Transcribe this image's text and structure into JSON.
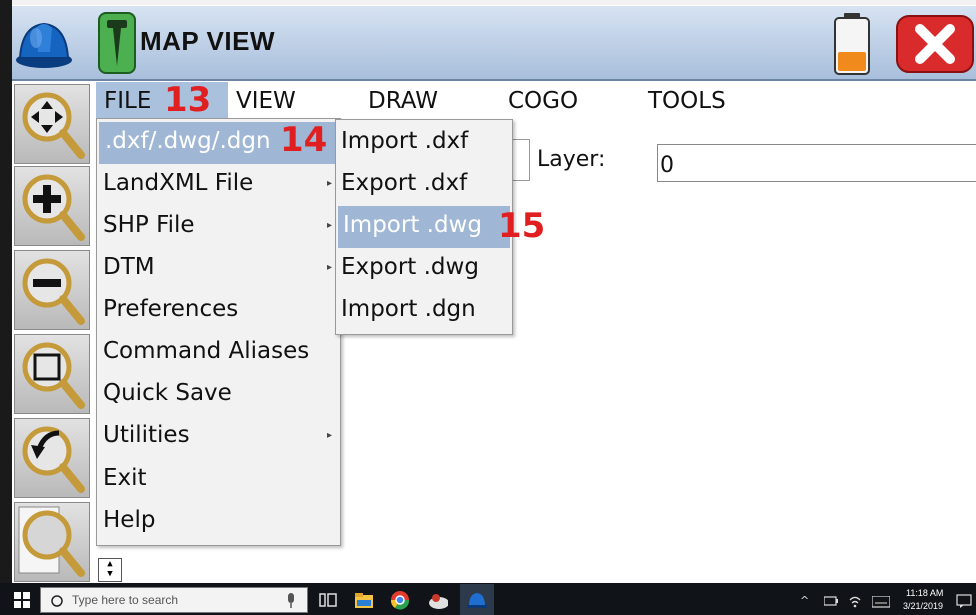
{
  "app": {
    "title": "MAP VIEW"
  },
  "menu_bar": {
    "items": [
      "FILE",
      "VIEW",
      "DRAW",
      "COGO",
      "TOOLS"
    ]
  },
  "annotations": {
    "step_file": "13",
    "step_dxf": "14",
    "step_import_dwg": "15"
  },
  "file_menu": {
    "items": [
      {
        "label": ".dxf/.dwg/.dgn",
        "has_submenu": true,
        "selected": true
      },
      {
        "label": "LandXML File",
        "has_submenu": true
      },
      {
        "label": "SHP File",
        "has_submenu": true
      },
      {
        "label": "DTM",
        "has_submenu": true
      },
      {
        "label": "Preferences",
        "has_submenu": false
      },
      {
        "label": "Command Aliases",
        "has_submenu": false
      },
      {
        "label": "Quick Save",
        "has_submenu": false
      },
      {
        "label": "Utilities",
        "has_submenu": true
      },
      {
        "label": "Exit",
        "has_submenu": false
      },
      {
        "label": "Help",
        "has_submenu": false
      }
    ]
  },
  "sub_menu": {
    "items": [
      {
        "label": "Import .dxf"
      },
      {
        "label": "Export .dxf"
      },
      {
        "label": "Import .dwg",
        "selected": true
      },
      {
        "label": "Export .dwg"
      },
      {
        "label": "Import .dgn"
      }
    ]
  },
  "layer": {
    "label": "Layer:",
    "value": "0"
  },
  "taskbar": {
    "search_placeholder": "Type here to search",
    "time": "11:18 AM",
    "date": "3/21/2019"
  },
  "colors": {
    "title_bar": "#b8cbe4",
    "menu_selected": "#9fb7d4",
    "annotation_red": "#e02020",
    "close_button": "#d92b2b"
  }
}
